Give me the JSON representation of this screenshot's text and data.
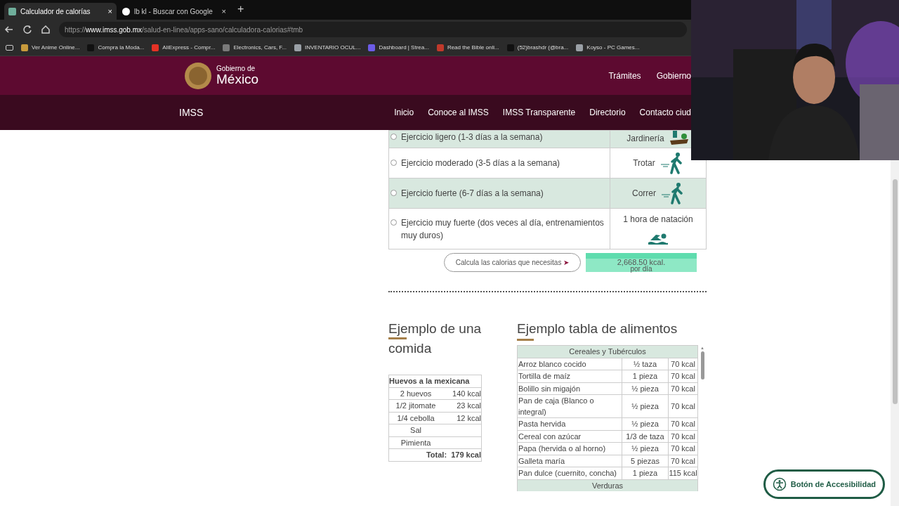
{
  "browser": {
    "tabs": [
      {
        "title": "Calculador de calorías",
        "close": "×",
        "selected": true
      },
      {
        "title": "lb kl - Buscar con Google",
        "close": "×",
        "selected": false
      }
    ],
    "new_tab": "+",
    "url": {
      "scheme": "https://",
      "host": "www.imss.gob.mx",
      "path": "/salud-en-linea/apps-sano/calculadora-calorias#tmb"
    },
    "bookmarks": [
      {
        "label": "Ver Anime Online...",
        "color": "#c89a3c"
      },
      {
        "label": "Compra la Moda...",
        "color": "#111111"
      },
      {
        "label": "AliExpress - Compr...",
        "color": "#e43225"
      },
      {
        "label": "Electronics, Cars, F...",
        "color": "#7a7a7a"
      },
      {
        "label": "INVENTARIO OCUL...",
        "color": "#9aa0a6"
      },
      {
        "label": "Dashboard | Strea...",
        "color": "#6c5ce7"
      },
      {
        "label": "Read the Bible onli...",
        "color": "#c0392b"
      },
      {
        "label": "(52)brashdr (@bra...",
        "color": "#111111"
      },
      {
        "label": "Koyso - PC Games...",
        "color": "#9aa0a6"
      }
    ]
  },
  "header": {
    "logo_line1": "Gobierno de",
    "logo_line2": "México",
    "links": [
      "Trámites",
      "Gobierno"
    ]
  },
  "nav": {
    "brand": "IMSS",
    "items": [
      "Inicio",
      "Conoce al IMSS",
      "IMSS Transparente",
      "Directorio",
      "Contacto ciud"
    ]
  },
  "activity": [
    {
      "label": "Ejercicio ligero (1-3 días a la semana)",
      "example": "Jardinería",
      "kind": "garden",
      "selected": false
    },
    {
      "label": "Ejercicio moderado (3-5 días a la semana)",
      "example": "Trotar",
      "kind": "walk",
      "selected": false
    },
    {
      "label": "Ejercicio fuerte (6-7 días a la semana)",
      "example": "Correr",
      "kind": "walk",
      "selected": false
    },
    {
      "label": "Ejercicio muy fuerte (dos veces al día, entrenamientos muy duros)",
      "example": "1 hora de natación",
      "kind": "swim",
      "selected": false
    }
  ],
  "calc_button": "Calcula las calorias que necesitas",
  "calc_arrow": "➤",
  "result": {
    "value": "2,668.50 kcal.",
    "unit": "por día"
  },
  "meal": {
    "title": "Ejemplo de una comida",
    "dish": "Huevos a la mexicana",
    "rows": [
      [
        "2 huevos",
        "140 kcal"
      ],
      [
        "1/2 jitomate",
        "23 kcal"
      ],
      [
        "1/4 cebolla",
        "12 kcal"
      ],
      [
        "Sal",
        ""
      ],
      [
        "Pimienta",
        ""
      ]
    ],
    "total_label": "Total:",
    "total": "179 kcal"
  },
  "foods": {
    "title": "Ejemplo tabla de alimentos",
    "group": "Cereales y Tubérculos",
    "rows": [
      [
        "Arroz blanco cocido",
        "½ taza",
        "70 kcal"
      ],
      [
        "Tortilla de maíz",
        "1 pieza",
        "70 kcal"
      ],
      [
        "Bolillo sin migajón",
        "½ pieza",
        "70 kcal"
      ],
      [
        "Pan de caja (Blanco o integral)",
        "½ pieza",
        "70 kcal"
      ],
      [
        "Pasta hervida",
        "½ pieza",
        "70 kcal"
      ],
      [
        "Cereal con azúcar",
        "1/3 de taza",
        "70 kcal"
      ],
      [
        "Papa (hervida o al horno)",
        "½ pieza",
        "70 kcal"
      ],
      [
        "Galleta maría",
        "5 piezas",
        "70 kcal"
      ],
      [
        "Pan dulce (cuernito, concha)",
        "1 pieza",
        "115 kcal"
      ]
    ],
    "next_group": "Verduras",
    "scroll_up": "▲"
  },
  "accessibility_button": "Botón de Accesibilidad"
}
